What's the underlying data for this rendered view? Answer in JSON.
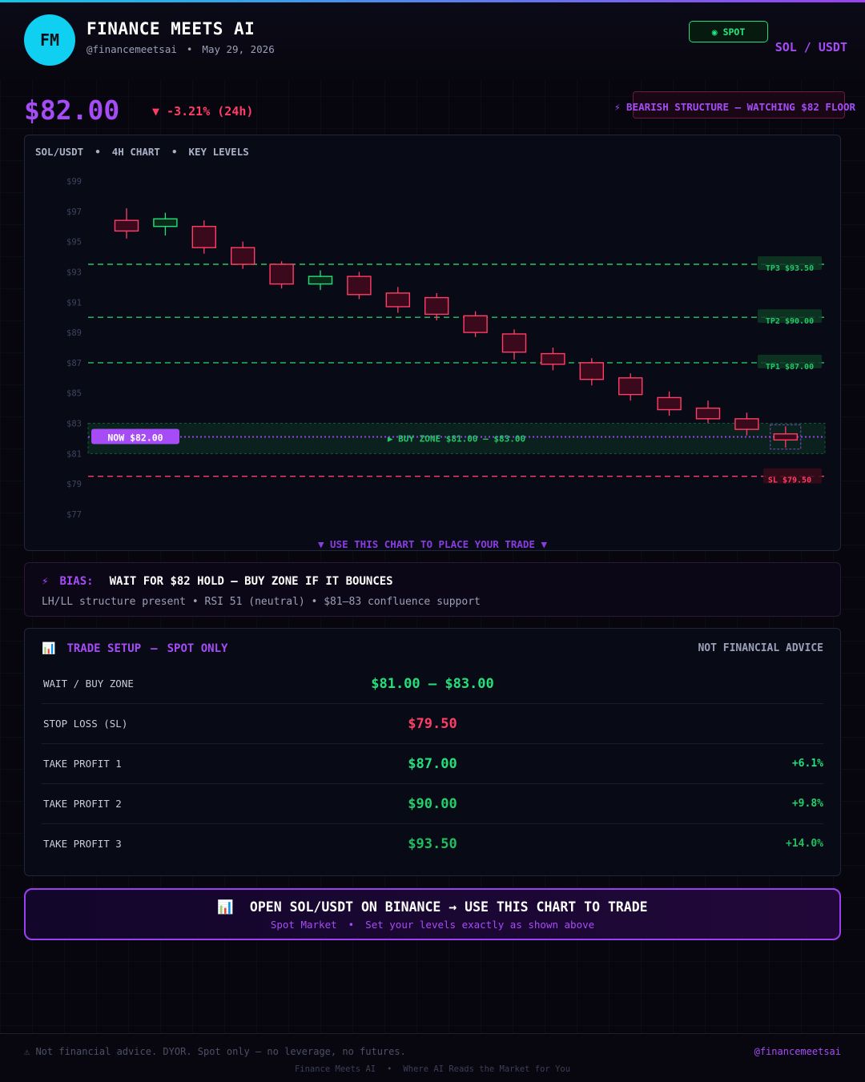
{
  "header": {
    "avatar_initials": "FM",
    "brand_name": "FINANCE MEETS AI",
    "handle": "@financemeetsai",
    "separator": "•",
    "date": "May 29, 2026",
    "spot_badge": "◉ SPOT",
    "pair": "SOL / USDT"
  },
  "ticker": {
    "price": "$82.00",
    "change": "▼ -3.21% (24h)",
    "bias_badge": "⚡ BEARISH STRUCTURE — WATCHING $82 FLOOR"
  },
  "chart_panel": {
    "pair": "SOL/USDT",
    "timeframe": "4H CHART",
    "subtitle": "KEY LEVELS",
    "sep": "•",
    "footer": "▼  USE THIS CHART TO PLACE YOUR TRADE  ▼"
  },
  "chart_data": {
    "type": "candlestick",
    "title": "",
    "xlabel": "",
    "ylabel": "",
    "ylim": [
      76.5,
      99.5
    ],
    "y_ticks": [
      "$99",
      "$97",
      "$95",
      "$93",
      "$91",
      "$89",
      "$87",
      "$85",
      "$83",
      "$81",
      "$79",
      "$77"
    ],
    "y_tick_values": [
      99,
      97,
      95,
      93,
      91,
      89,
      87,
      85,
      83,
      81,
      79,
      77
    ],
    "candles": [
      {
        "open": 95.7,
        "close": 96.4,
        "high": 97.2,
        "low": 95.2,
        "dir": "down"
      },
      {
        "open": 96.0,
        "close": 96.5,
        "high": 96.9,
        "low": 95.4,
        "dir": "up"
      },
      {
        "open": 94.6,
        "close": 96.0,
        "high": 96.4,
        "low": 94.2,
        "dir": "down"
      },
      {
        "open": 93.5,
        "close": 94.6,
        "high": 95.0,
        "low": 93.2,
        "dir": "down"
      },
      {
        "open": 92.2,
        "close": 93.5,
        "high": 93.7,
        "low": 91.9,
        "dir": "down"
      },
      {
        "open": 92.2,
        "close": 92.7,
        "high": 93.1,
        "low": 91.8,
        "dir": "up"
      },
      {
        "open": 91.5,
        "close": 92.7,
        "high": 93.0,
        "low": 91.2,
        "dir": "down"
      },
      {
        "open": 90.7,
        "close": 91.6,
        "high": 92.0,
        "low": 90.3,
        "dir": "down"
      },
      {
        "open": 90.2,
        "close": 91.3,
        "high": 91.6,
        "low": 89.8,
        "dir": "down"
      },
      {
        "open": 89.0,
        "close": 90.1,
        "high": 90.4,
        "low": 88.7,
        "dir": "down"
      },
      {
        "open": 87.7,
        "close": 88.9,
        "high": 89.2,
        "low": 87.2,
        "dir": "down"
      },
      {
        "open": 86.9,
        "close": 87.6,
        "high": 88.0,
        "low": 86.5,
        "dir": "down"
      },
      {
        "open": 85.9,
        "close": 87.0,
        "high": 87.3,
        "low": 85.5,
        "dir": "down"
      },
      {
        "open": 84.9,
        "close": 86.0,
        "high": 86.3,
        "low": 84.5,
        "dir": "down"
      },
      {
        "open": 83.9,
        "close": 84.7,
        "high": 85.1,
        "low": 83.5,
        "dir": "down"
      },
      {
        "open": 83.3,
        "close": 84.0,
        "high": 84.5,
        "low": 83.0,
        "dir": "down"
      },
      {
        "open": 82.6,
        "close": 83.3,
        "high": 83.7,
        "low": 82.2,
        "dir": "down"
      },
      {
        "open": 81.9,
        "close": 82.3,
        "high": 82.8,
        "low": 81.4,
        "dir": "down"
      }
    ],
    "levels": [
      {
        "name": "TP3",
        "value": 93.5,
        "label": "TP3 $93.50",
        "color": "#22c768"
      },
      {
        "name": "TP2",
        "value": 90.0,
        "label": "TP2 $90.00",
        "color": "#22c768"
      },
      {
        "name": "TP1",
        "value": 87.0,
        "label": "TP1 $87.00",
        "color": "#22c768"
      },
      {
        "name": "SL",
        "value": 79.5,
        "label": "SL $79.50",
        "color": "#ff3d66"
      }
    ],
    "buy_zone": {
      "low": 81.0,
      "high": 83.0,
      "label": "▶ BUY ZONE  $81.00 – $83.00"
    },
    "now": {
      "value": 82.0,
      "label": "NOW  $82.00"
    },
    "colors": {
      "up": "#22e07a",
      "down": "#ff3d66",
      "buy_zone": "#0f3a2a",
      "now_line": "#9b40f0"
    }
  },
  "bias": {
    "icon": "⚡",
    "label": "BIAS:",
    "value": "WAIT FOR $82 HOLD — BUY ZONE IF IT BOUNCES",
    "detail": "LH/LL structure present • RSI 51 (neutral) • $81–83 confluence support"
  },
  "setup": {
    "icon": "📊",
    "title": "TRADE SETUP",
    "dash": "—",
    "subtitle": "SPOT ONLY",
    "disclaimer": "NOT FINANCIAL ADVICE",
    "rows": [
      {
        "label": "WAIT / BUY ZONE",
        "value": "$81.00 – $83.00",
        "pct": "",
        "color": "#22e07a"
      },
      {
        "label": "STOP LOSS (SL)",
        "value": "$79.50",
        "pct": "",
        "color": "#ff3d66"
      },
      {
        "label": "TAKE PROFIT 1",
        "value": "$87.00",
        "pct": "+6.1%",
        "color": "#22e07a"
      },
      {
        "label": "TAKE PROFIT 2",
        "value": "$90.00",
        "pct": "+9.8%",
        "color": "#22d06a"
      },
      {
        "label": "TAKE PROFIT 3",
        "value": "$93.50",
        "pct": "+14.0%",
        "color": "#1fbf60"
      }
    ]
  },
  "cta": {
    "icon": "📊",
    "main": "OPEN SOL/USDT ON BINANCE → USE THIS CHART TO TRADE",
    "sub_left": "Spot Market",
    "sep": "•",
    "sub_right": "Set your levels exactly as shown above"
  },
  "footer": {
    "disclaimer": "⚠ Not financial advice. DYOR. Spot only — no leverage, no futures.",
    "handle": "@financemeetsai",
    "tagline_left": "Finance Meets AI",
    "sep": "•",
    "tagline_right": "Where AI Reads the Market for You"
  }
}
